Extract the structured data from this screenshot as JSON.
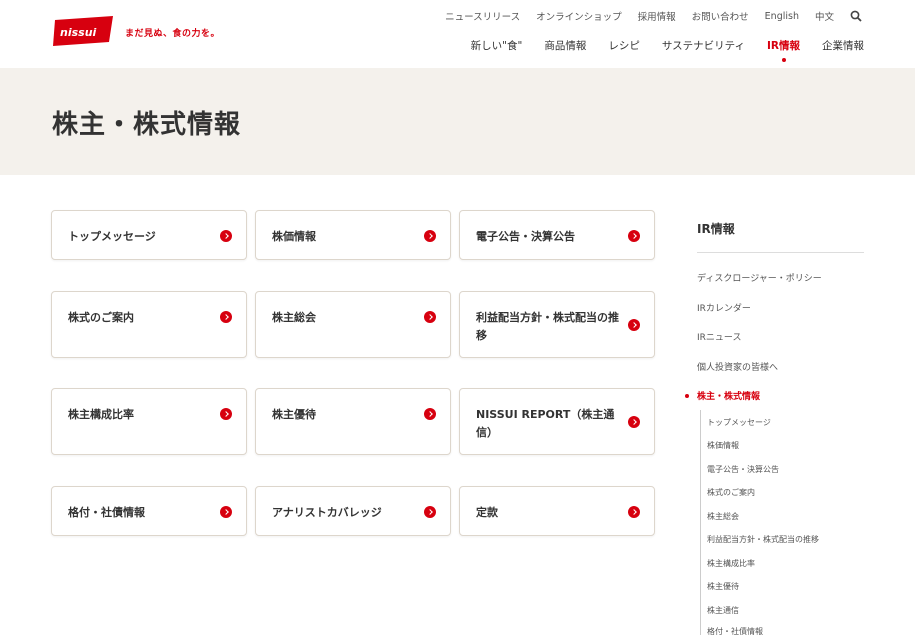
{
  "brand": {
    "logo_text": "nissui",
    "tagline": "まだ見ぬ、食の力を。",
    "accent_color": "#d7000f"
  },
  "utility_nav": [
    "ニュースリリース",
    "オンラインショップ",
    "採用情報",
    "お問い合わせ",
    "English",
    "中文"
  ],
  "main_nav": [
    {
      "label": "新しい\"食\"",
      "active": false
    },
    {
      "label": "商品情報",
      "active": false
    },
    {
      "label": "レシピ",
      "active": false
    },
    {
      "label": "サステナビリティ",
      "active": false
    },
    {
      "label": "IR情報",
      "active": true
    },
    {
      "label": "企業情報",
      "active": false
    }
  ],
  "page_title": "株主・株式情報",
  "cards": [
    "トップメッセージ",
    "株価情報",
    "電子公告・決算公告",
    "株式のご案内",
    "株主総会",
    "利益配当方針・株式配当の推移",
    "株主構成比率",
    "株主優待",
    "NISSUI REPORT（株主通信）",
    "格付・社債情報",
    "アナリストカバレッジ",
    "定款"
  ],
  "sidebar": {
    "title": "IR情報",
    "links": [
      "ディスクロージャー・ポリシー",
      "IRカレンダー",
      "IRニュース",
      "個人投資家の皆様へ",
      "株主・株式情報"
    ],
    "active_link": "株主・株式情報",
    "sub_links": [
      "トップメッセージ",
      "株価情報",
      "電子公告・決算公告",
      "株式のご案内",
      "株主総会",
      "利益配当方針・株式配当の推移",
      "株主構成比率",
      "株主優待",
      "株主通信",
      "格付・社債情報"
    ]
  }
}
